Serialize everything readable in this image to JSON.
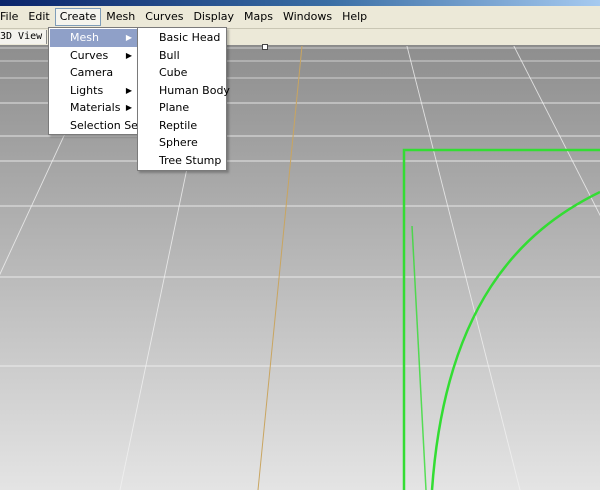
{
  "menubar": {
    "items": [
      {
        "label": "File"
      },
      {
        "label": "Edit"
      },
      {
        "label": "Create"
      },
      {
        "label": "Mesh"
      },
      {
        "label": "Curves"
      },
      {
        "label": "Display"
      },
      {
        "label": "Maps"
      },
      {
        "label": "Windows"
      },
      {
        "label": "Help"
      }
    ],
    "active": "Create"
  },
  "viewport": {
    "label": "3D View",
    "background_top": "#8e8e8e",
    "background_bottom": "#e4e4e4",
    "grid_color": "#f2f2f2",
    "axis_color": "#c9a560",
    "object_color": "#33dd33"
  },
  "create_menu": {
    "items": [
      {
        "label": "Mesh",
        "has_submenu": true,
        "highlighted": true
      },
      {
        "label": "Curves",
        "has_submenu": true
      },
      {
        "label": "Camera",
        "has_submenu": false
      },
      {
        "label": "Lights",
        "has_submenu": true
      },
      {
        "label": "Materials",
        "has_submenu": true
      },
      {
        "label": "Selection Set",
        "has_submenu": false
      }
    ],
    "highlight_color": "#8fa0c8",
    "arrow_glyph": "▶"
  },
  "mesh_submenu": {
    "items": [
      {
        "label": "Basic Head"
      },
      {
        "label": "Bull"
      },
      {
        "label": "Cube"
      },
      {
        "label": "Human Body"
      },
      {
        "label": "Plane"
      },
      {
        "label": "Reptile"
      },
      {
        "label": "Sphere"
      },
      {
        "label": "Tree Stump"
      }
    ]
  }
}
